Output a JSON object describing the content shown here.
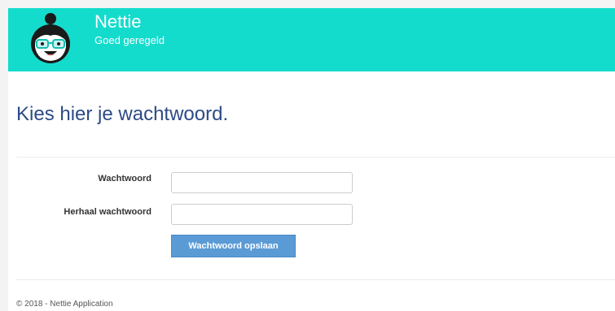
{
  "header": {
    "brand_name": "Nettie",
    "tagline": "Goed geregeld",
    "logo_icon": "nettie-avatar-icon",
    "background_color": "#14dccd"
  },
  "main": {
    "title": "Kies hier je wachtwoord.",
    "form": {
      "password_label": "Wachtwoord",
      "password_value": "",
      "confirm_label": "Herhaal wachtwoord",
      "confirm_value": "",
      "submit_label": "Wachtwoord opslaan"
    }
  },
  "footer": {
    "text": "© 2018 - Nettie Application"
  },
  "colors": {
    "accent": "#14dccd",
    "title": "#2d4a86",
    "button": "#5b9bd5"
  }
}
